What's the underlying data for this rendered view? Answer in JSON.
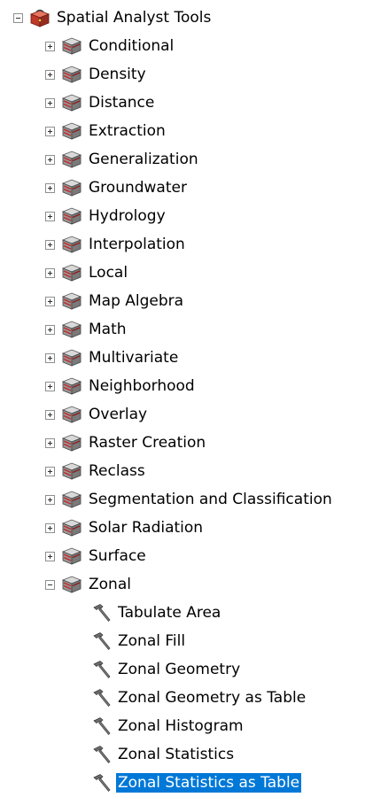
{
  "tree": {
    "root": {
      "label": "Spatial Analyst Tools",
      "icon": "red-toolbox-icon",
      "expanded": true
    },
    "toolsets": [
      {
        "label": "Conditional",
        "icon": "toolset-icon",
        "expanded": false
      },
      {
        "label": "Density",
        "icon": "toolset-icon",
        "expanded": false
      },
      {
        "label": "Distance",
        "icon": "toolset-icon",
        "expanded": false
      },
      {
        "label": "Extraction",
        "icon": "toolset-icon",
        "expanded": false
      },
      {
        "label": "Generalization",
        "icon": "toolset-icon",
        "expanded": false
      },
      {
        "label": "Groundwater",
        "icon": "toolset-icon",
        "expanded": false
      },
      {
        "label": "Hydrology",
        "icon": "toolset-icon",
        "expanded": false
      },
      {
        "label": "Interpolation",
        "icon": "toolset-icon",
        "expanded": false
      },
      {
        "label": "Local",
        "icon": "toolset-icon",
        "expanded": false
      },
      {
        "label": "Map Algebra",
        "icon": "toolset-icon",
        "expanded": false
      },
      {
        "label": "Math",
        "icon": "toolset-icon",
        "expanded": false
      },
      {
        "label": "Multivariate",
        "icon": "toolset-icon",
        "expanded": false
      },
      {
        "label": "Neighborhood",
        "icon": "toolset-icon",
        "expanded": false
      },
      {
        "label": "Overlay",
        "icon": "toolset-icon",
        "expanded": false
      },
      {
        "label": "Raster Creation",
        "icon": "toolset-icon",
        "expanded": false
      },
      {
        "label": "Reclass",
        "icon": "toolset-icon",
        "expanded": false
      },
      {
        "label": "Segmentation and Classification",
        "icon": "toolset-icon",
        "expanded": false
      },
      {
        "label": "Solar Radiation",
        "icon": "toolset-icon",
        "expanded": false
      },
      {
        "label": "Surface",
        "icon": "toolset-icon",
        "expanded": false
      },
      {
        "label": "Zonal",
        "icon": "toolset-icon",
        "expanded": true
      }
    ],
    "zonal_tools": [
      {
        "label": "Tabulate Area",
        "icon": "hammer-icon",
        "selected": false
      },
      {
        "label": "Zonal Fill",
        "icon": "hammer-icon",
        "selected": false
      },
      {
        "label": "Zonal Geometry",
        "icon": "hammer-icon",
        "selected": false
      },
      {
        "label": "Zonal Geometry as Table",
        "icon": "hammer-icon",
        "selected": false
      },
      {
        "label": "Zonal Histogram",
        "icon": "hammer-icon",
        "selected": false
      },
      {
        "label": "Zonal Statistics",
        "icon": "hammer-icon",
        "selected": false
      },
      {
        "label": "Zonal Statistics as Table",
        "icon": "hammer-icon",
        "selected": true
      }
    ]
  },
  "colors": {
    "selection": "#0078d7",
    "selection_text": "#ffffff",
    "text": "#000000"
  }
}
